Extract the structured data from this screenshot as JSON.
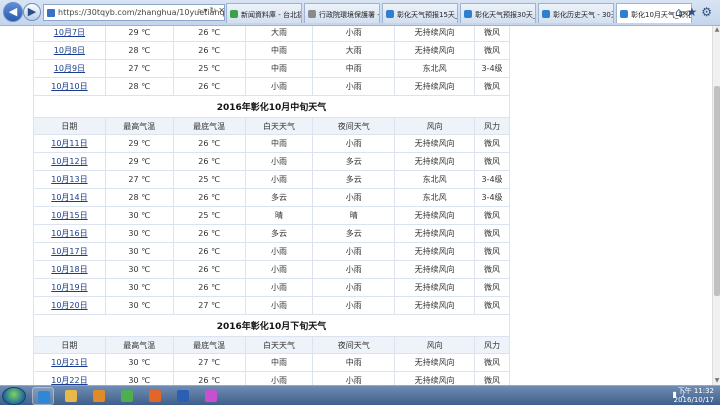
{
  "browser": {
    "url": "https://30tqyb.com/zhanghua/10yuetianqi/",
    "tabs": [
      {
        "label": "新闻資料庫 - 台北捷工...",
        "active": false,
        "icon_color": "#3aa14a"
      },
      {
        "label": "行政院環境保護署 - 空...",
        "active": false,
        "icon_color": "#8a8a8a"
      },
      {
        "label": "彰化天气预报15天_彰...",
        "active": false,
        "icon_color": "#2f7fd0"
      },
      {
        "label": "彰化天气预报30天_彰...",
        "active": false,
        "icon_color": "#2f7fd0"
      },
      {
        "label": "彰化历史天气 - 30天...",
        "active": false,
        "icon_color": "#2f7fd0"
      },
      {
        "label": "彰化10月天气_彰化...",
        "active": true,
        "icon_color": "#2f7fd0"
      }
    ]
  },
  "sections": [
    {
      "title": "",
      "header": null,
      "rows": [
        {
          "date": "10月7日",
          "high": "29 ℃",
          "low": "26 ℃",
          "day": "大雨",
          "night": "小雨",
          "wind_dir": "无持续风向",
          "wind": "微风"
        },
        {
          "date": "10月8日",
          "high": "28 ℃",
          "low": "26 ℃",
          "day": "中雨",
          "night": "大雨",
          "wind_dir": "无持续风向",
          "wind": "微风"
        },
        {
          "date": "10月9日",
          "high": "27 ℃",
          "low": "25 ℃",
          "day": "中雨",
          "night": "中雨",
          "wind_dir": "东北风",
          "wind": "3-4级"
        },
        {
          "date": "10月10日",
          "high": "28 ℃",
          "low": "26 ℃",
          "day": "小雨",
          "night": "小雨",
          "wind_dir": "无持续风向",
          "wind": "微风"
        }
      ]
    },
    {
      "title": "2016年彰化10月中旬天气",
      "header": {
        "date": "日期",
        "high": "最高气温",
        "low": "最底气温",
        "day": "白天天气",
        "night": "夜间天气",
        "wind_dir": "风向",
        "wind": "风力"
      },
      "rows": [
        {
          "date": "10月11日",
          "high": "29 ℃",
          "low": "26 ℃",
          "day": "中雨",
          "night": "小雨",
          "wind_dir": "无持续风向",
          "wind": "微风"
        },
        {
          "date": "10月12日",
          "high": "29 ℃",
          "low": "26 ℃",
          "day": "小雨",
          "night": "多云",
          "wind_dir": "无持续风向",
          "wind": "微风"
        },
        {
          "date": "10月13日",
          "high": "27 ℃",
          "low": "25 ℃",
          "day": "小雨",
          "night": "多云",
          "wind_dir": "东北风",
          "wind": "3-4级"
        },
        {
          "date": "10月14日",
          "high": "28 ℃",
          "low": "26 ℃",
          "day": "多云",
          "night": "小雨",
          "wind_dir": "东北风",
          "wind": "3-4级"
        },
        {
          "date": "10月15日",
          "high": "30 ℃",
          "low": "25 ℃",
          "day": "晴",
          "night": "晴",
          "wind_dir": "无持续风向",
          "wind": "微风"
        },
        {
          "date": "10月16日",
          "high": "30 ℃",
          "low": "26 ℃",
          "day": "多云",
          "night": "多云",
          "wind_dir": "无持续风向",
          "wind": "微风"
        },
        {
          "date": "10月17日",
          "high": "30 ℃",
          "low": "26 ℃",
          "day": "小雨",
          "night": "小雨",
          "wind_dir": "无持续风向",
          "wind": "微风"
        },
        {
          "date": "10月18日",
          "high": "30 ℃",
          "low": "26 ℃",
          "day": "小雨",
          "night": "小雨",
          "wind_dir": "无持续风向",
          "wind": "微风"
        },
        {
          "date": "10月19日",
          "high": "30 ℃",
          "low": "26 ℃",
          "day": "小雨",
          "night": "小雨",
          "wind_dir": "无持续风向",
          "wind": "微风"
        },
        {
          "date": "10月20日",
          "high": "30 ℃",
          "low": "27 ℃",
          "day": "小雨",
          "night": "小雨",
          "wind_dir": "无持续风向",
          "wind": "微风"
        }
      ]
    },
    {
      "title": "2016年彰化10月下旬天气",
      "header": {
        "date": "日期",
        "high": "最高气温",
        "low": "最底气温",
        "day": "白天天气",
        "night": "夜间天气",
        "wind_dir": "风向",
        "wind": "风力"
      },
      "rows": [
        {
          "date": "10月21日",
          "high": "30 ℃",
          "low": "27 ℃",
          "day": "中雨",
          "night": "中雨",
          "wind_dir": "无持续风向",
          "wind": "微风"
        },
        {
          "date": "10月22日",
          "high": "30 ℃",
          "low": "26 ℃",
          "day": "小雨",
          "night": "小雨",
          "wind_dir": "无持续风向",
          "wind": "微风"
        }
      ]
    }
  ],
  "taskbar": {
    "apps": [
      {
        "icon": "ie-icon",
        "color": "#2f87d6",
        "running": true
      },
      {
        "icon": "folder-icon",
        "color": "#e8b84a",
        "running": false
      },
      {
        "icon": "media-player-icon",
        "color": "#e08a2a",
        "running": false
      },
      {
        "icon": "chrome-icon",
        "color": "#4caf50",
        "running": false
      },
      {
        "icon": "firefox-icon",
        "color": "#e0662a",
        "running": false
      },
      {
        "icon": "word-icon",
        "color": "#2b5fb3",
        "running": false
      },
      {
        "icon": "picture-icon",
        "color": "#c84fd0",
        "running": false
      }
    ],
    "time": "下午 11:32",
    "date": "2016/10/17"
  }
}
